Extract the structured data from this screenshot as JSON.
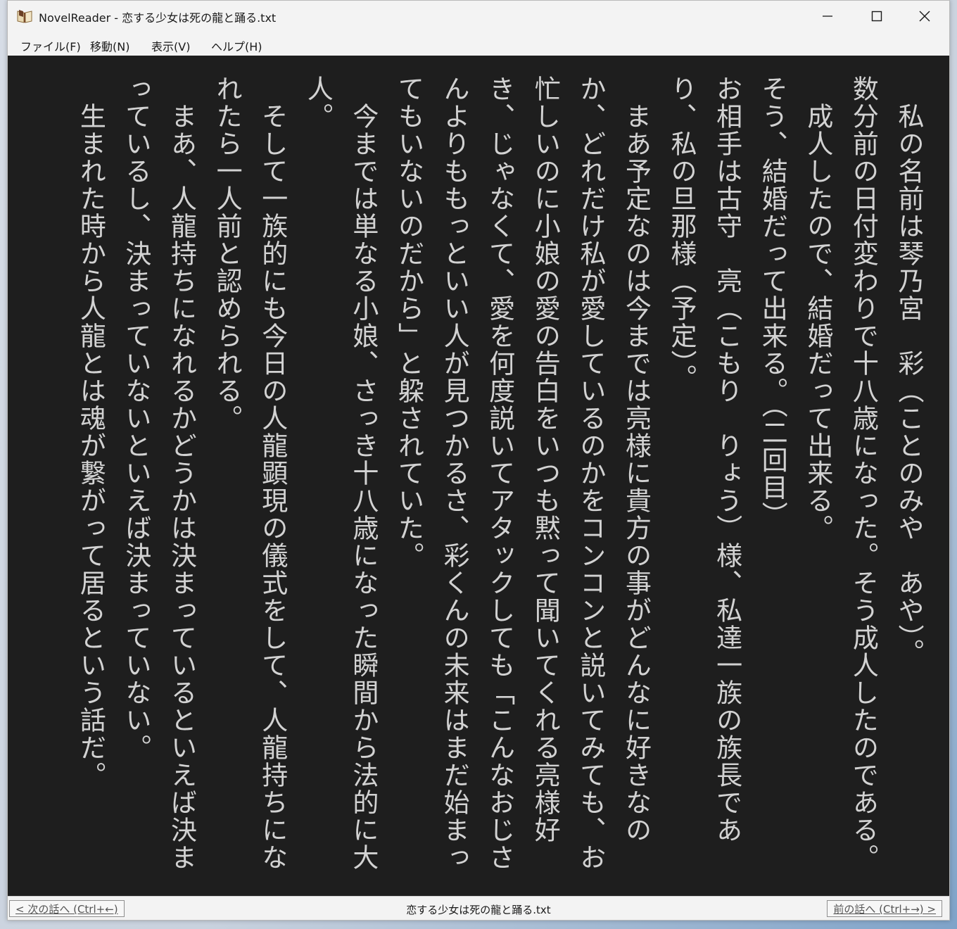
{
  "window": {
    "title": "NovelReader - 恋する少女は死の龍と踊る.txt",
    "controls": {
      "minimize": "minimize",
      "maximize": "maximize",
      "close": "close"
    }
  },
  "menu": {
    "items": [
      {
        "label": "ファイル(F)"
      },
      {
        "label": "移動(N)"
      },
      {
        "label": "表示(V)"
      },
      {
        "label": "ヘルプ(H)"
      }
    ]
  },
  "reader": {
    "paragraphs": [
      "　私の名前は琴乃宮　彩（ことのみや　あや）。",
      "数分前の日付変わりで十八歳になった。そう成人したのである。",
      "　成人したので、結婚だって出来る。",
      "そう、結婚だって出来る。（二回目）",
      "お相手は古守　亮（こもり　りょう）様、私達一族の族長であり、私の旦那様（予定）。",
      "　まあ予定なのは今までは亮様に貴方の事がどんなに好きなのか、どれだけ私が愛しているのかをコンコンと説いてみても、お忙しいのに小娘の愛の告白をいつも黙って聞いてくれる亮様好き、じゃなくて、愛を何度説いてアタックしても「こんなおじさんよりももっといい人が見つかるさ、彩くんの未来はまだ始まってもいないのだから」と躱されていた。",
      "　今までは単なる小娘、さっき十八歳になった瞬間から法的に大人。",
      "　そして一族的にも今日の人龍顕現の儀式をして、人龍持ちになれたら一人前と認められる。",
      "　まあ、人龍持ちになれるかどうかは決まっているといえば決まっているし、決まっていないといえば決まっていない。",
      "　生まれた時から人龍とは魂が繋がって居るという話だ。"
    ]
  },
  "statusbar": {
    "next_label": "< 次の話へ (Ctrl+←)",
    "prev_label": "前の話へ (Ctrl+→) >",
    "file_name": "恋する少女は死の龍と踊る.txt"
  }
}
